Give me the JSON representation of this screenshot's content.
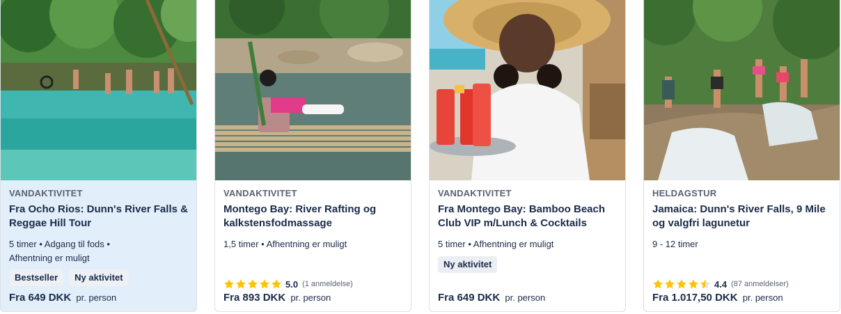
{
  "cards": [
    {
      "category": "VANDAKTIVITET",
      "title": "Fra Ocho Rios: Dunn's River Falls & Reggae Hill Tour",
      "meta_line1": "5 timer • Adgang til fods •",
      "meta_line2": "Afhentning er muligt",
      "badges": [
        "Bestseller",
        "Ny aktivitet"
      ],
      "price_amount": "Fra 649 DKK",
      "price_unit": "pr. person",
      "image": "river-swimmers-photo"
    },
    {
      "category": "VANDAKTIVITET",
      "title": "Montego Bay: River Rafting og kalkstensfodmassage",
      "meta_line1": "1,5 timer • Afhentning er muligt",
      "rating_value": "5.0",
      "rating_count": "(1 anmeldelse)",
      "rating_stars": 5,
      "price_amount": "Fra 893 DKK",
      "price_unit": "pr. person",
      "image": "bamboo-raft-photo"
    },
    {
      "category": "VANDAKTIVITET",
      "title": "Fra Montego Bay: Bamboo Beach Club VIP m/Lunch & Cocktails",
      "meta_line1": "5 timer • Afhentning er muligt",
      "badges": [
        "Ny aktivitet"
      ],
      "price_amount": "Fra 649 DKK",
      "price_unit": "pr. person",
      "image": "cocktail-waitress-photo"
    },
    {
      "category": "HELDAGSTUR",
      "title": "Jamaica: Dunn's River Falls, 9 Mile og valgfri lagunetur",
      "meta_line1": "9 - 12 timer",
      "rating_value": "4.4",
      "rating_count": "(87 anmeldelser)",
      "rating_stars": 4.5,
      "price_amount": "Fra 1.017,50 DKK",
      "price_unit": "pr. person",
      "image": "waterfall-climb-photo"
    }
  ],
  "colors": {
    "text": "#1a2b49",
    "muted": "#5a6272",
    "highlight_bg": "#e3eefb",
    "star": "#ffc400"
  }
}
